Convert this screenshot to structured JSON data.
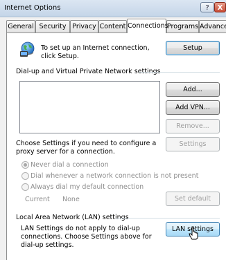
{
  "window": {
    "title": "Internet Options",
    "help_glyph": "?",
    "close_glyph": "X"
  },
  "tabs": [
    {
      "label": "General"
    },
    {
      "label": "Security"
    },
    {
      "label": "Privacy"
    },
    {
      "label": "Content"
    },
    {
      "label": "Connections"
    },
    {
      "label": "Programs"
    },
    {
      "label": "Advanced"
    }
  ],
  "active_tab": "Connections",
  "setup_section": {
    "icon": "globe-network-icon",
    "text": "To set up an Internet connection, click Setup.",
    "button": "Setup"
  },
  "dialup_section": {
    "heading": "Dial-up and Virtual Private Network settings",
    "list_items": [],
    "add_button": "Add...",
    "add_vpn_button": "Add VPN...",
    "remove_button": "Remove...",
    "proxy_text": "Choose Settings if you need to configure a proxy server for a connection.",
    "settings_button": "Settings",
    "radio_options": [
      {
        "label": "Never dial a connection",
        "selected": true
      },
      {
        "label": "Dial whenever a network connection is not present",
        "selected": false
      },
      {
        "label": "Always dial my default connection",
        "selected": false
      }
    ],
    "current_label": "Current",
    "current_value": "None",
    "set_default_button": "Set default"
  },
  "lan_section": {
    "heading": "Local Area Network (LAN) settings",
    "text": "LAN Settings do not apply to dial-up connections. Choose Settings above for dial-up settings.",
    "button": "LAN settings"
  },
  "colors": {
    "accent": "#3c7fb1",
    "hover_blue": "#bee6fd",
    "disabled_text": "#a0a0a0"
  }
}
